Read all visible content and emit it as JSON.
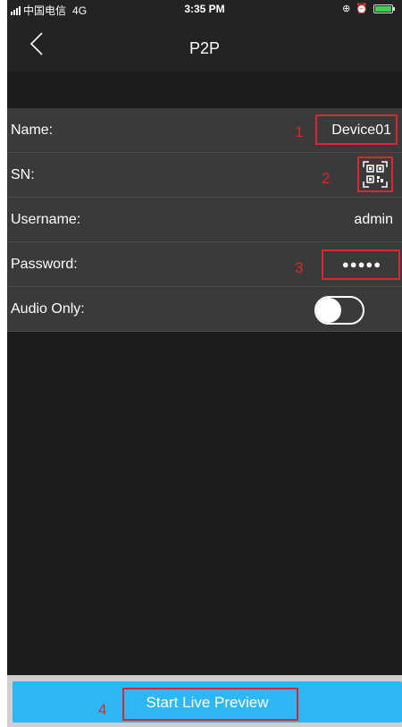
{
  "status_bar": {
    "carrier": "中国电信",
    "network": "4G",
    "time": "3:35 PM"
  },
  "nav": {
    "title": "P2P",
    "back_icon": "chevron-left-icon"
  },
  "form": {
    "name_label": "Name:",
    "name_value": "Device01",
    "sn_label": "SN:",
    "sn_icon": "qr-code-icon",
    "username_label": "Username:",
    "username_value": "admin",
    "password_label": "Password:",
    "password_value": "●●●●●",
    "audio_label": "Audio Only:",
    "audio_only_on": false
  },
  "annotations": {
    "one": "1",
    "two": "2",
    "three": "3",
    "four": "4"
  },
  "footer": {
    "start_label": "Start Live Preview"
  },
  "colors": {
    "accent": "#2db8f5",
    "annotation": "#d9282f",
    "background": "#1c1c1c",
    "row": "#3a3a3a"
  }
}
